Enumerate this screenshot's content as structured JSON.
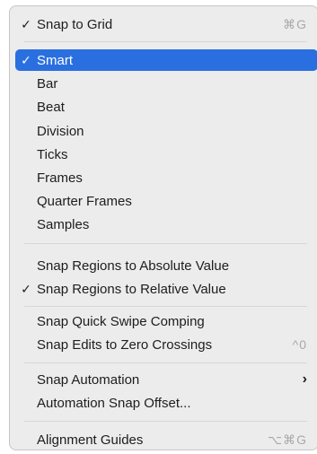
{
  "menu": {
    "items": [
      {
        "label": "Snap to Grid",
        "checked": true,
        "shortcut": "⌘G"
      },
      {
        "label": "Smart",
        "checked": true,
        "selected": true
      },
      {
        "label": "Bar"
      },
      {
        "label": "Beat"
      },
      {
        "label": "Division"
      },
      {
        "label": "Ticks"
      },
      {
        "label": "Frames"
      },
      {
        "label": "Quarter Frames"
      },
      {
        "label": "Samples"
      },
      {
        "label": "Snap Regions to Absolute Value"
      },
      {
        "label": "Snap Regions to Relative Value",
        "checked": true
      },
      {
        "label": "Snap Quick Swipe Comping"
      },
      {
        "label": "Snap Edits to Zero Crossings",
        "shortcut": "^0"
      },
      {
        "label": "Snap Automation",
        "submenu": true
      },
      {
        "label": "Automation Snap Offset..."
      },
      {
        "label": "Alignment Guides",
        "shortcut": "⌥⌘G"
      }
    ],
    "checkmark_glyph": "✓",
    "submenu_glyph": "›",
    "colors": {
      "selection": "#2a6fe0",
      "background": "#ececec",
      "shortcut_text": "#a9a9a9"
    }
  }
}
